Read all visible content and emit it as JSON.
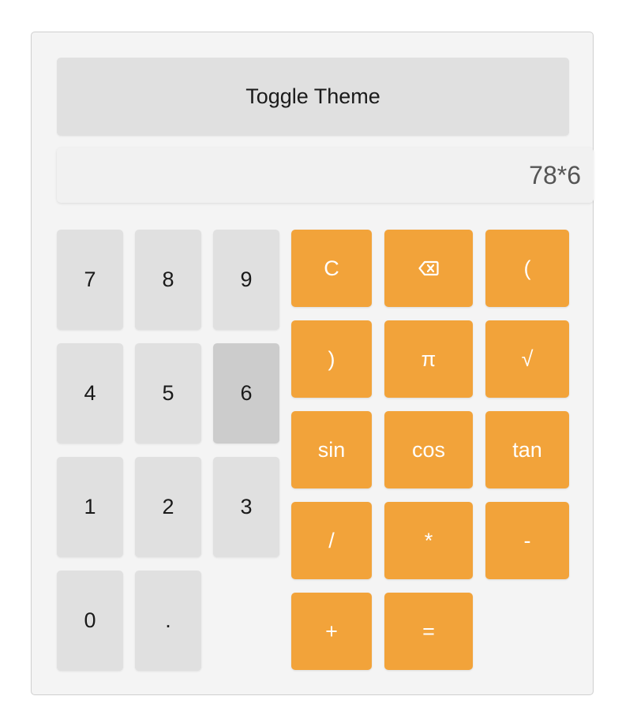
{
  "toggle_theme_label": "Toggle Theme",
  "display": {
    "expression": "78*6"
  },
  "numpad": {
    "k7": "7",
    "k8": "8",
    "k9": "9",
    "k4": "4",
    "k5": "5",
    "k6": "6",
    "k1": "1",
    "k2": "2",
    "k3": "3",
    "k0": "0",
    "kdot": "."
  },
  "operators": {
    "clear": "C",
    "backspace_icon": "backspace-icon",
    "open_paren": "(",
    "close_paren": ")",
    "pi": "π",
    "sqrt": "√",
    "sin": "sin",
    "cos": "cos",
    "tan": "tan",
    "divide": "/",
    "multiply": "*",
    "subtract": "-",
    "add": "+",
    "equals": "="
  },
  "colors": {
    "operator_bg": "#f2a33a",
    "number_bg": "#e0e0e0",
    "pressed_bg": "#cccccc",
    "panel_bg": "#f4f4f4"
  },
  "state": {
    "pressed_key": "6"
  }
}
